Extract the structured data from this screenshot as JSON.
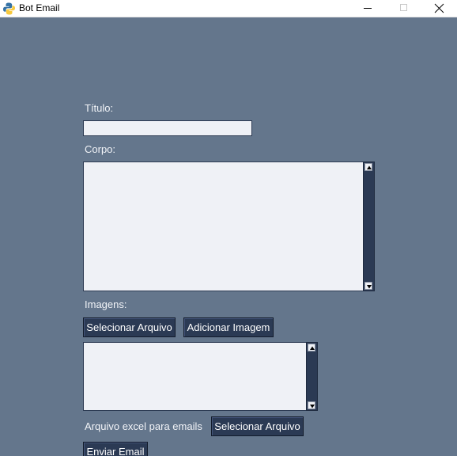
{
  "window": {
    "title": "Bot Email"
  },
  "form": {
    "titulo_label": "Título:",
    "titulo_value": "",
    "corpo_label": "Corpo:",
    "corpo_value": "",
    "imagens_label": "Imagens:",
    "select_image_button": "Selecionar Arquivo",
    "add_image_button": "Adicionar Imagem",
    "images_list_value": "",
    "excel_label": "Arquivo excel para emails",
    "select_excel_button": "Selecionar Arquivo",
    "send_button": "Enviar Email"
  },
  "colors": {
    "background": "#64768c",
    "field": "#eff1f6",
    "button": "#2b3a54",
    "text": "#f2f4f8"
  },
  "icons": {
    "app": "python-icon",
    "minimize": "minimize-icon",
    "maximize": "maximize-icon",
    "close": "close-icon",
    "scroll_up": "arrow-up-icon",
    "scroll_down": "arrow-down-icon"
  }
}
